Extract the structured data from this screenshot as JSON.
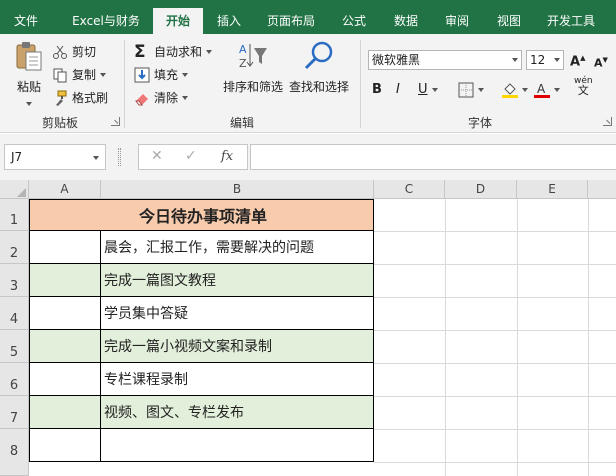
{
  "tabs": [
    {
      "label": "文件",
      "active": false
    },
    {
      "label": "Excel与财务",
      "active": false
    },
    {
      "label": "开始",
      "active": true
    },
    {
      "label": "插入",
      "active": false
    },
    {
      "label": "页面布局",
      "active": false
    },
    {
      "label": "公式",
      "active": false
    },
    {
      "label": "数据",
      "active": false
    },
    {
      "label": "审阅",
      "active": false
    },
    {
      "label": "视图",
      "active": false
    },
    {
      "label": "开发工具",
      "active": false
    }
  ],
  "ribbon": {
    "clipboard": {
      "paste": "粘贴",
      "cut": "剪切",
      "copy": "复制",
      "format_painter": "格式刷",
      "group_label": "剪贴板"
    },
    "editing": {
      "autosum": "自动求和",
      "fill": "填充",
      "clear": "清除",
      "sort_filter": "排序和筛选",
      "find_select": "查找和选择",
      "group_label": "编辑"
    },
    "font": {
      "font_name": "微软雅黑",
      "font_size": "12",
      "bold": "B",
      "italic": "I",
      "underline": "U",
      "phonetic": "wén",
      "group_label": "字体",
      "fill_color": "#ffd700",
      "font_color": "#e00000"
    }
  },
  "formula_bar": {
    "name_box": "J7",
    "fx": "fx",
    "formula": ""
  },
  "sheet": {
    "columns": [
      "A",
      "B",
      "C",
      "D",
      "E"
    ],
    "rows": [
      "1",
      "2",
      "3",
      "4",
      "5",
      "6",
      "7",
      "8"
    ],
    "title": "今日待办事项清单",
    "title_fill": "#f8cbad",
    "band_fill": "#e2efda",
    "tasks": [
      "晨会，汇报工作，需要解决的问题",
      "完成一篇图文教程",
      "学员集中答疑",
      "完成一篇小视频文案和录制",
      "专栏课程录制",
      "视频、图文、专栏发布",
      ""
    ]
  }
}
